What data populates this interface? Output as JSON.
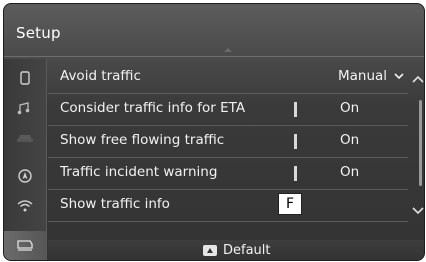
{
  "header": {
    "title": "Setup"
  },
  "sidebar": {
    "icons": [
      "phone-icon",
      "music-note-icon",
      "car-icon",
      "navigation-icon",
      "wifi-icon",
      "traffic-icon"
    ]
  },
  "settings": {
    "rows": [
      {
        "label": "Avoid traffic",
        "value": "Manual",
        "control": "dropdown"
      },
      {
        "label": "Consider traffic info for ETA",
        "value": "On",
        "control": "toggle"
      },
      {
        "label": "Show free flowing traffic",
        "value": "On",
        "control": "toggle"
      },
      {
        "label": "Traffic incident warning",
        "value": "On",
        "control": "toggle"
      },
      {
        "label": "Show traffic info",
        "value": "",
        "control": "link"
      }
    ]
  },
  "annotation": {
    "callout": "F"
  },
  "footer": {
    "default_label": "Default"
  }
}
